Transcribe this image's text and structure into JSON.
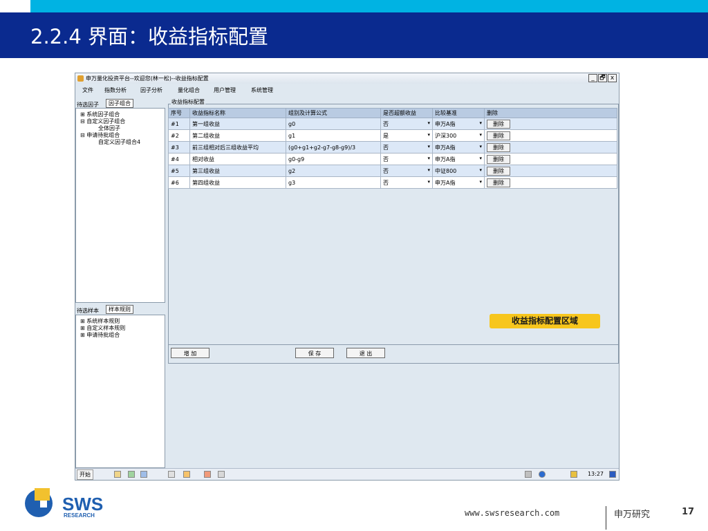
{
  "slide": {
    "title": "2.2.4 界面：收益指标配置",
    "footer_url": "www.swsresearch.com",
    "footer_org": "申万研究",
    "page_number": "17",
    "logo_text": "SWS",
    "logo_subtext": "RESEARCH",
    "accent": "#00b3e3",
    "band_color": "#0a2a8f"
  },
  "window": {
    "title": "申万量化投资平台--欢迎您(林一松)--收益指标配置",
    "controls": {
      "minimize": "_",
      "restore": "🗗",
      "close": "x"
    },
    "menu": [
      "文件",
      "指数分析",
      "因子分析",
      "量化组合",
      "用户管理",
      "系统管理"
    ]
  },
  "left_top": {
    "header": "待选因子",
    "tab": "因子组合",
    "tree": [
      "⊞ 系统因子组合",
      "⊟ 自定义因子组合",
      "全体因子",
      "⊟ 申请待批组合",
      "自定义因子组合4"
    ]
  },
  "left_bottom": {
    "header": "待选样本",
    "tab": "样本规则",
    "tree": [
      "⊞ 系统样本规则",
      "⊞ 自定义样本规则",
      "⊞ 申请待批组合"
    ]
  },
  "main": {
    "group_title": "收益指标配置",
    "columns": [
      "序号",
      "收益指标名称",
      "组别及计算公式",
      "是否超额收益",
      "比较基准",
      "删除"
    ],
    "rows": [
      {
        "id": "#1",
        "name": "第一组收益",
        "formula": "g0",
        "excess": "否",
        "benchmark": "申万A指",
        "del": "删除"
      },
      {
        "id": "#2",
        "name": "第二组收益",
        "formula": "g1",
        "excess": "是",
        "benchmark": "沪深300",
        "del": "删除"
      },
      {
        "id": "#3",
        "name": "前三组相对后三组收益平均",
        "formula": "(g0+g1+g2-g7-g8-g9)/3",
        "excess": "否",
        "benchmark": "申万A指",
        "del": "删除"
      },
      {
        "id": "#4",
        "name": "相对收益",
        "formula": "g0-g9",
        "excess": "否",
        "benchmark": "申万A指",
        "del": "删除"
      },
      {
        "id": "#5",
        "name": "第三组收益",
        "formula": "g2",
        "excess": "否",
        "benchmark": "中证800",
        "del": "删除"
      },
      {
        "id": "#6",
        "name": "第四组收益",
        "formula": "g3",
        "excess": "否",
        "benchmark": "申万A指",
        "del": "删除"
      }
    ],
    "callout": "收益指标配置区域",
    "buttons": {
      "add": "增 加",
      "save": "保 存",
      "exit": "退 出"
    }
  },
  "taskbar": {
    "start": "开始",
    "clock": "13:27"
  }
}
